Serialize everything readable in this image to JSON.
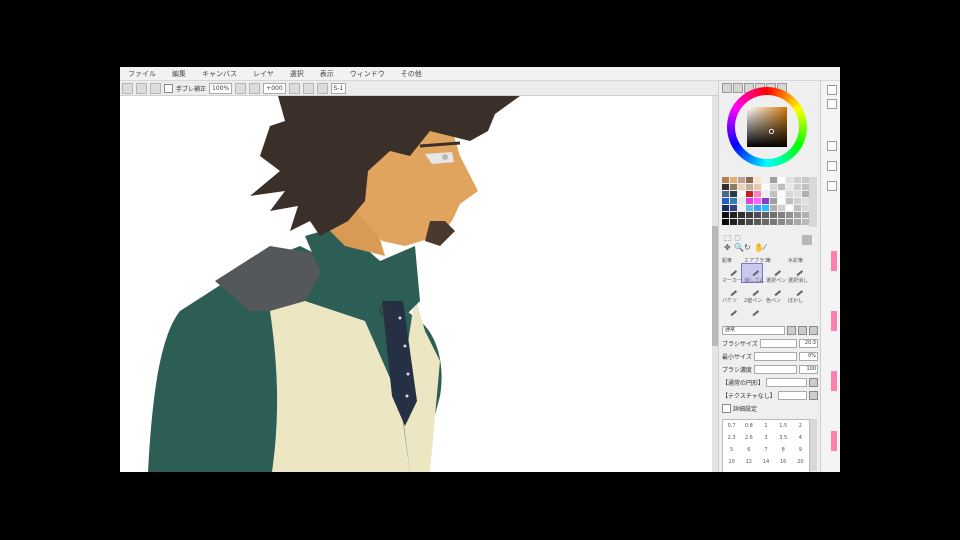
{
  "menu": [
    {
      "label": "ファイル"
    },
    {
      "label": "編集"
    },
    {
      "label": "キャンバス"
    },
    {
      "label": "レイヤ"
    },
    {
      "label": "選択"
    },
    {
      "label": "表示"
    },
    {
      "label": "ウィンドウ"
    },
    {
      "label": "その他"
    }
  ],
  "toolbar": {
    "antialias_label": "手ブレ補正",
    "zoom_value": "100%",
    "angle_value": "+000",
    "stabilizer_value": "S-1"
  },
  "colors": {
    "skin": "#e0a45e",
    "hair": "#3b2f2a",
    "shirt": "#2d5e55",
    "vest": "#ece7c2",
    "shoulder": "#55585a",
    "current_color": "#2a1e14"
  },
  "swatches": [
    "#b08050",
    "#e0b070",
    "#c0a090",
    "#8a6a50",
    "#ffe0c0",
    "#f0f0f0",
    "#a0a0a0",
    "#ffffff",
    "#e0e0e0",
    "#d0d0d0",
    "#c8c8c8",
    "#b8b8b8",
    "#303030",
    "#8a7a6a",
    "#f0d0b0",
    "#c0b0a0",
    "#e8c8a8",
    "#ffffff",
    "#d8d8d8",
    "#c0c0c0",
    "#e8e8e8",
    "#d0d0d0",
    "#c0c0c0",
    "#a8a8a8",
    "#4a6a8a",
    "#2a3a4a",
    "#ffffff",
    "#c02020",
    "#ff80c0",
    "#f0f0f0",
    "#c0c0c0",
    "#ffffff",
    "#d8d8d8",
    "#e0e0e0",
    "#b0b0b0",
    "#c8c8c8",
    "#2060c0",
    "#3a7ab0",
    "#e8e8e8",
    "#e040e0",
    "#ff60ff",
    "#8040c0",
    "#a0a0a0",
    "#ffffff",
    "#c0c0c0",
    "#d0d0d0",
    "#e0e0e0",
    "#b0b0b0",
    "#1a2a6a",
    "#304080",
    "#f0f0f0",
    "#60c0e0",
    "#40a0ff",
    "#20c0ff",
    "#b0b0b0",
    "#d0d0d0",
    "#ffffff",
    "#c0c0c0",
    "#d8d8d8",
    "#a8a8a8",
    "#101010",
    "#202020",
    "#303030",
    "#404040",
    "#505050",
    "#606060",
    "#707070",
    "#808080",
    "#909090",
    "#a0a0a0",
    "#b0b0b0",
    "#c0c0c0",
    "#0a0a0a",
    "#202020",
    "#383838",
    "#484848",
    "#585858",
    "#686868",
    "#787878",
    "#888888",
    "#989898",
    "#a8a8a8",
    "#b8b8b8",
    "#c8c8c8"
  ],
  "tools": [
    {
      "label": "鉛筆"
    },
    {
      "label": "エアブラシ"
    },
    {
      "label": "筆"
    },
    {
      "label": "水彩筆"
    },
    {
      "label": "マーカー"
    },
    {
      "label": "消しゴム"
    },
    {
      "label": "選択ペン"
    },
    {
      "label": "選択消し"
    },
    {
      "label": "バケツ"
    },
    {
      "label": "2値ペン"
    },
    {
      "label": "色ペン"
    },
    {
      "label": "ぼかし"
    }
  ],
  "brush": {
    "mode": "通常",
    "size_label": "ブラシサイズ",
    "size_value": "20.3",
    "min_size_label": "最小サイズ",
    "min_size_value": "0%",
    "density_label": "ブラシ濃度",
    "density_value": "100",
    "texture_label": "【通常の円形】",
    "texture2_label": "【テクスチャなし】",
    "detail_label": "詳細設定"
  },
  "size_presets": [
    "0.7",
    "0.8",
    "1",
    "1.5",
    "2",
    "2.3",
    "2.6",
    "3",
    "3.5",
    "4",
    "5",
    "6",
    "7",
    "8",
    "9",
    "10",
    "12",
    "14",
    "16",
    "20"
  ]
}
